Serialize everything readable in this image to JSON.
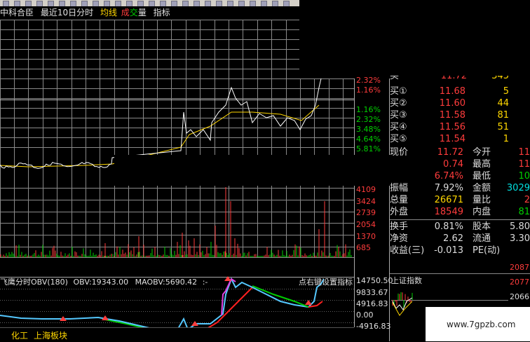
{
  "header": {
    "stock_name": "中科合臣",
    "mode_label": "最近10日分时",
    "ma_label": "均线",
    "cj_label_1": "成",
    "cj_label_2": "交",
    "vol_label": "量",
    "indicator_label": "指标"
  },
  "price_axis": {
    "up_labels": [
      "2.32%",
      "1.16%"
    ],
    "down_labels": [
      "1.16%",
      "2.32%",
      "3.48%",
      "4.64%",
      "5.81%"
    ]
  },
  "volume_axis": [
    "4109",
    "3424",
    "2739",
    "2054",
    "1370",
    "685"
  ],
  "obv": {
    "title": "飞鹰分时OBV(180)",
    "obv_label": "OBV:19343.00",
    "maobv_label": "MAOBV:5690.42",
    "marker": ":-",
    "hint": "点右键设置指标",
    "axis": [
      "14750.50",
      "9833.67",
      "4916.83",
      "0.00",
      "-4916.83"
    ]
  },
  "bottom_tabs": {
    "tab1": "化工",
    "tab2": "上海板块"
  },
  "quotes": {
    "buy": [
      {
        "label": "买①",
        "price": "11.68",
        "vol": "5"
      },
      {
        "label": "买②",
        "price": "11.60",
        "vol": "44"
      },
      {
        "label": "买③",
        "price": "11.58",
        "vol": "81"
      },
      {
        "label": "买④",
        "price": "11.56",
        "vol": "51"
      },
      {
        "label": "买⑤",
        "price": "11.54",
        "vol": "1"
      }
    ],
    "top_partial": {
      "price": "11.72",
      "vol": "345"
    },
    "now": {
      "label": "现价",
      "value": "11.72",
      "label2": "今开",
      "value2": "11"
    },
    "change": {
      "value": "0.74",
      "label2": "最高",
      "value2": "11"
    },
    "change_pct": {
      "value": "6.74%",
      "label2": "最低",
      "value2": "10"
    },
    "amplitude": {
      "label": "振幅",
      "value": "7.92%",
      "label2": "金额",
      "value2": "3029"
    },
    "total": {
      "label": "总量",
      "value": "26671",
      "label2": "量比",
      "value2": "2"
    },
    "outer": {
      "label": "外盘",
      "value": "18549",
      "label2": "内盘",
      "value2": "81"
    },
    "turnover": {
      "label": "换手",
      "value": "0.81%",
      "label2": "股本",
      "value2": "5.80"
    },
    "net_assets": {
      "label": "净资",
      "value": "2.62",
      "label2": "流通",
      "value2": "3.30"
    },
    "eps": {
      "label": "收益(三)",
      "value": "-0.013",
      "label2": "PE(动)",
      "value2": ""
    }
  },
  "index_panel": {
    "title": "上证指数",
    "axis": [
      "2087",
      "2077",
      "2066"
    ]
  },
  "watermark": "www.7gpzb.com",
  "colors": {
    "up": "#ff3c3c",
    "down": "#00d000",
    "grid": "#8a8a8a",
    "price_line": "#ffffff",
    "avg_line": "#ffd700",
    "ma_green": "#00cc00",
    "ma_red": "#ff2020",
    "obv_cyan": "#55c8ff"
  }
}
